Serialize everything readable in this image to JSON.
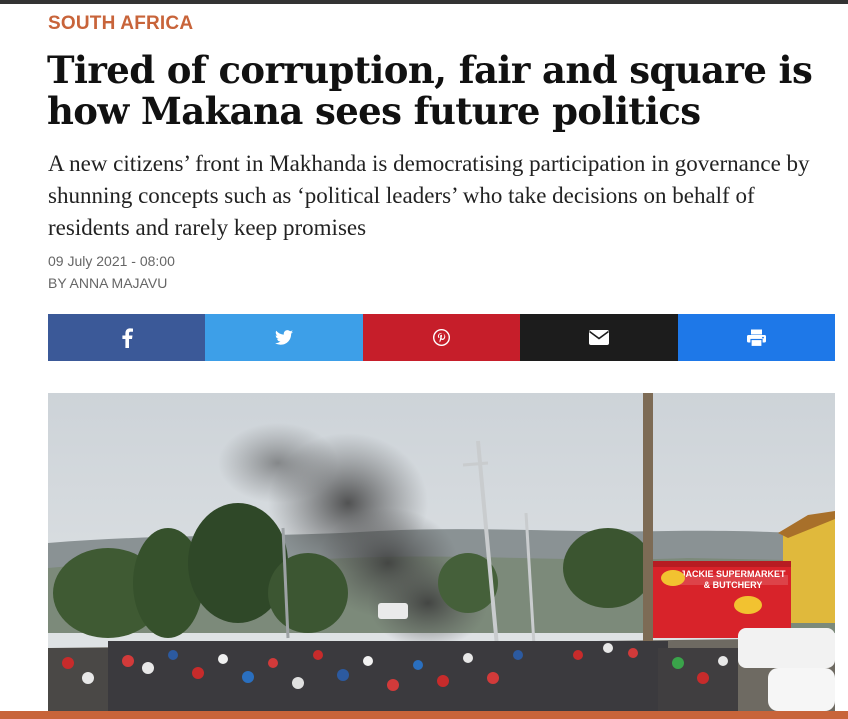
{
  "article": {
    "category": "SOUTH AFRICA",
    "headline": "Tired of corruption, fair and square is how Makana sees future politics",
    "standfirst": "A new citizens’ front in Makhanda is democratising participation in governance by shunning concepts such as ‘political leaders’ who take decisions on behalf of residents and rarely keep promises",
    "date": "09 July 2021 - 08:00",
    "byline": "BY ANNA MAJAVU"
  },
  "share": [
    {
      "network": "facebook",
      "icon": "facebook-icon",
      "color": "#3b5998"
    },
    {
      "network": "twitter",
      "icon": "twitter-icon",
      "color": "#3d9fe8"
    },
    {
      "network": "pinterest",
      "icon": "pinterest-icon",
      "color": "#c61e2a"
    },
    {
      "network": "email",
      "icon": "envelope-icon",
      "color": "#1c1c1c"
    },
    {
      "network": "print",
      "icon": "printer-icon",
      "color": "#1e78e8"
    }
  ],
  "hero_image": {
    "storefront_sign": [
      "JACKIE SUPERMARKET",
      "& BUTCHERY"
    ]
  },
  "colors": {
    "accent": "#c8643a",
    "topbar": "#333333"
  }
}
